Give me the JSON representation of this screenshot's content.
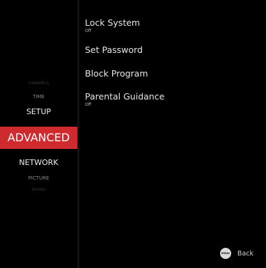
{
  "categories": {
    "channels": "CHANNELS",
    "time": "TIME",
    "setup": "SETUP",
    "advanced": "ADVANCED",
    "network": "NETWORK",
    "picture": "PICTURE",
    "sound": "SOUND"
  },
  "selected_category": "ADVANCED",
  "colors": {
    "accent": "#cf2b2e",
    "background": "#000000"
  },
  "options": [
    {
      "label": "Lock System",
      "value": "Off"
    },
    {
      "label": "Set Password"
    },
    {
      "label": "Block Program"
    },
    {
      "label": "Parental Guidance",
      "value": "Off"
    }
  ],
  "footer": {
    "key_icon": "menu-key-icon",
    "key_label": "MENU",
    "action_label": "Back"
  }
}
